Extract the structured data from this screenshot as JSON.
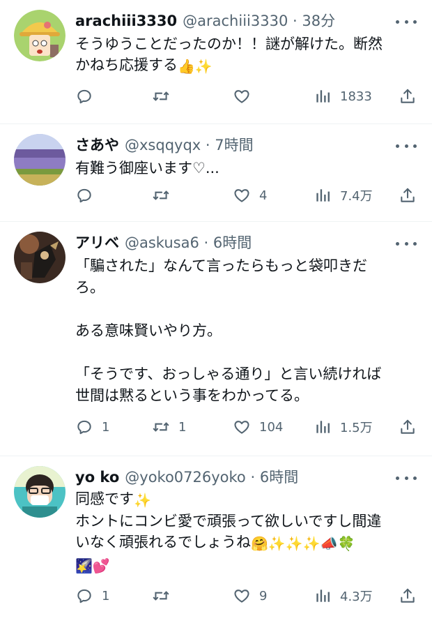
{
  "tweets": [
    {
      "name": "arachiii3330",
      "handle": "@arachiii3330",
      "time": "38分",
      "lines": [
        "そうゆうことだったのか！！謎が解けた。断然",
        "かねち応援する"
      ],
      "emojis": [
        "👍",
        "✨"
      ],
      "replies": "",
      "retweets": "",
      "likes": "",
      "views": "1833"
    },
    {
      "name": "さあや",
      "handle": "@xsqqyqx",
      "time": "7時間",
      "lines": [
        "有難う御座います♡..."
      ],
      "replies": "",
      "retweets": "",
      "likes": "4",
      "views": "7.4万"
    },
    {
      "name": "アリベ",
      "handle": "@askusa6",
      "time": "6時間",
      "lines": [
        "「騙された」なんて言ったらもっと袋叩きだ",
        "ろ。",
        "",
        "ある意味賢いやり方。",
        "",
        "「そうです、おっしゃる通り」と言い続ければ",
        "世間は黙るという事をわかってる。"
      ],
      "replies": "1",
      "retweets": "1",
      "likes": "104",
      "views": "1.5万"
    },
    {
      "name": "yo ko",
      "handle": "@yoko0726yoko",
      "time": "6時間",
      "lines": [
        "同感です",
        "ホントにコンビ愛で頑張って欲しいですし間違",
        "いなく頑張れるでしょうね"
      ],
      "emojis_line1": [
        "✨"
      ],
      "emojis_line3": [
        "🤗",
        "✨",
        "✨",
        "✨",
        "📣",
        "🍀"
      ],
      "emojis_line4": [
        "🌠",
        "💕"
      ],
      "replies": "1",
      "retweets": "",
      "likes": "9",
      "views": "4.3万"
    }
  ],
  "separator": " · ",
  "colors": {
    "text": "#0f1419",
    "secondary": "#536471",
    "border": "#eff3f4"
  },
  "icons": [
    "reply-icon",
    "retweet-icon",
    "like-icon",
    "views-icon",
    "share-icon",
    "more-icon"
  ]
}
